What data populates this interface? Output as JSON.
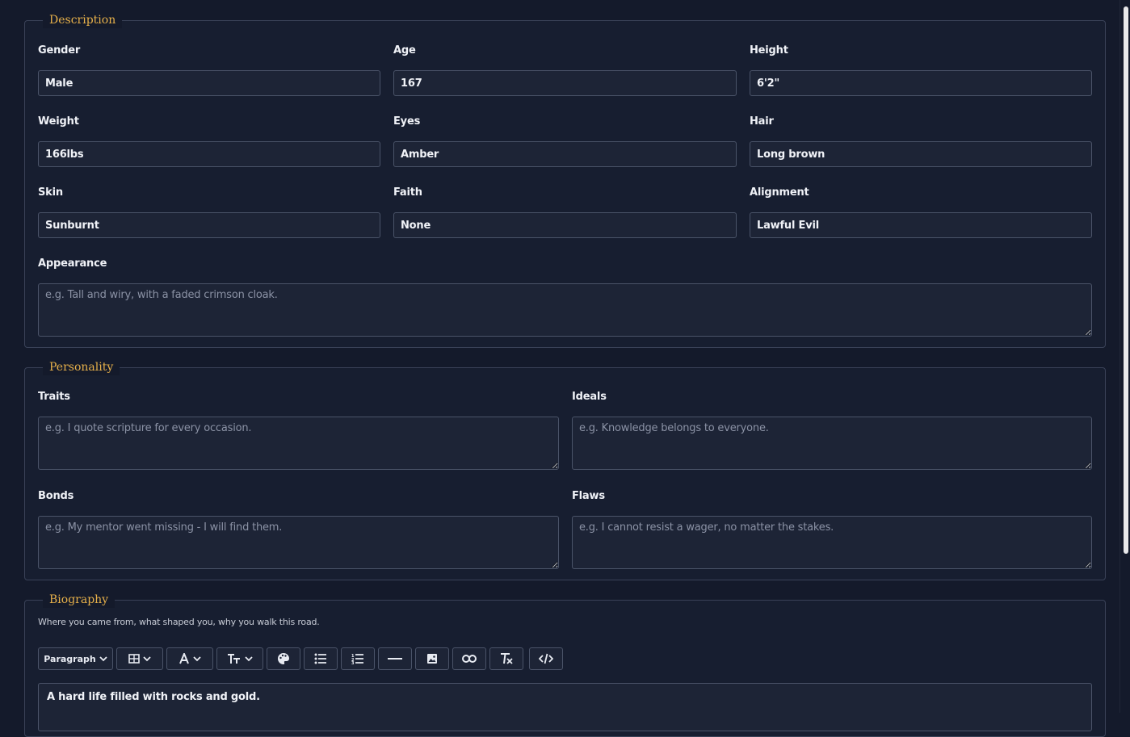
{
  "description": {
    "title": "Description",
    "fields": {
      "gender": {
        "label": "Gender",
        "value": "Male"
      },
      "age": {
        "label": "Age",
        "value": "167"
      },
      "height": {
        "label": "Height",
        "value": "6'2\""
      },
      "weight": {
        "label": "Weight",
        "value": "166lbs"
      },
      "eyes": {
        "label": "Eyes",
        "value": "Amber"
      },
      "hair": {
        "label": "Hair",
        "value": "Long brown"
      },
      "skin": {
        "label": "Skin",
        "value": "Sunburnt"
      },
      "faith": {
        "label": "Faith",
        "value": "None"
      },
      "alignment": {
        "label": "Alignment",
        "value": "Lawful Evil"
      }
    },
    "appearance": {
      "label": "Appearance",
      "placeholder": "e.g. Tall and wiry, with a faded crimson cloak."
    }
  },
  "personality": {
    "title": "Personality",
    "traits": {
      "label": "Traits",
      "placeholder": "e.g. I quote scripture for every occasion."
    },
    "ideals": {
      "label": "Ideals",
      "placeholder": "e.g. Knowledge belongs to everyone."
    },
    "bonds": {
      "label": "Bonds",
      "placeholder": "e.g. My mentor went missing - I will find them."
    },
    "flaws": {
      "label": "Flaws",
      "placeholder": "e.g. I cannot resist a wager, no matter the stakes."
    }
  },
  "biography": {
    "title": "Biography",
    "hint": "Where you came from, what shaped you, why you walk this road.",
    "toolbar": {
      "paragraph_label": "Paragraph",
      "icons": [
        "table-icon",
        "font-color-icon",
        "font-size-icon",
        "palette-icon",
        "bullet-list-icon",
        "numbered-list-icon",
        "horizontal-rule-icon",
        "image-icon",
        "link-icon",
        "clear-format-icon",
        "code-view-icon"
      ]
    },
    "content": "A hard life filled with rocks and gold."
  },
  "colors": {
    "background": "#141a2b",
    "accent": "#e6b04a",
    "border": "#4a5368"
  }
}
